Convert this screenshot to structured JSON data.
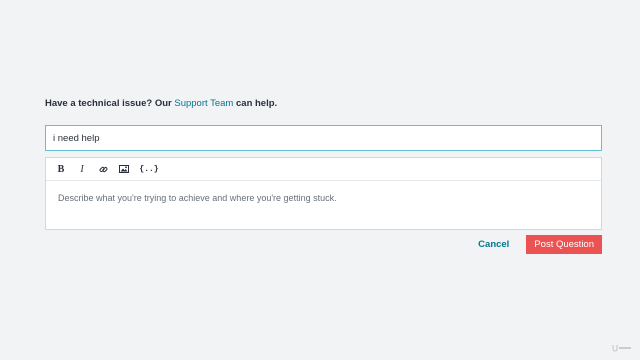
{
  "intro": {
    "prefix": "Have a technical issue? Our",
    "link_text": "Support Team",
    "suffix": "can help."
  },
  "question": {
    "title_value": "i need help"
  },
  "editor": {
    "toolbar": {
      "bold": "B",
      "italic": "I",
      "code": "{..}"
    },
    "placeholder": "Describe what you're trying to achieve and where you're getting stuck."
  },
  "actions": {
    "cancel_label": "Cancel",
    "post_label": "Post Question"
  },
  "colors": {
    "link": "#007791",
    "primary_button": "#ec5252",
    "focus_border": "#66c0d4"
  },
  "icons": [
    "link-icon",
    "image-icon"
  ]
}
